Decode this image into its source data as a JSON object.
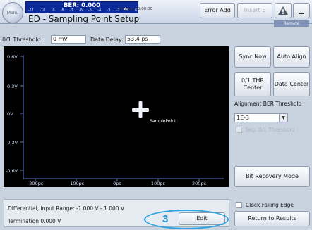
{
  "header": {
    "menu_label": "Menu",
    "ber_label": "BER: 0.000",
    "ber_scale": [
      "-11",
      "-10",
      "-9",
      "-8",
      "-7",
      "-6",
      "-5",
      "-4",
      "-3",
      "-2",
      "-1",
      "0"
    ],
    "elapsed": "Elapsed 00:00:00",
    "title": "ED - Sampling Point Setup",
    "error_add": "Error Add",
    "insert_label": "Insert E",
    "remote_label": "Remote"
  },
  "params": {
    "threshold_label": "0/1 Threshold:",
    "threshold_value": "0 mV",
    "delay_label": "Data Delay:",
    "delay_value": "53.4 ps"
  },
  "plot": {
    "y_ticks": [
      "0.6V",
      "0.3V",
      "0V",
      "-0.3V",
      "-0.6V"
    ],
    "x_ticks": [
      "-200ps",
      "-100ps",
      "0ps",
      "100ps",
      "200ps"
    ],
    "marker_label": "SamplePoint",
    "marker_color": "#ffffff"
  },
  "side": {
    "sync_now": "Sync Now",
    "auto_align": "Auto Align",
    "thr_center": "0/1 THR Center",
    "data_center": "Data Center",
    "alignment_label": "Alignment  BER Threshold",
    "ber_threshold_value": "1E-3",
    "seg_threshold": "Seg. 0/1 Threshold",
    "bit_recovery": "Bit Recovery Mode",
    "clock_falling": "Clock Falling Edge",
    "return_results": "Return to Results"
  },
  "bottom": {
    "input_range": "Differential, Input Range: -1.000 V - 1.000 V",
    "termination": "Termination 0.000 V",
    "edit": "Edit",
    "callout_number": "3",
    "callout_color": "#2aa3e0"
  }
}
